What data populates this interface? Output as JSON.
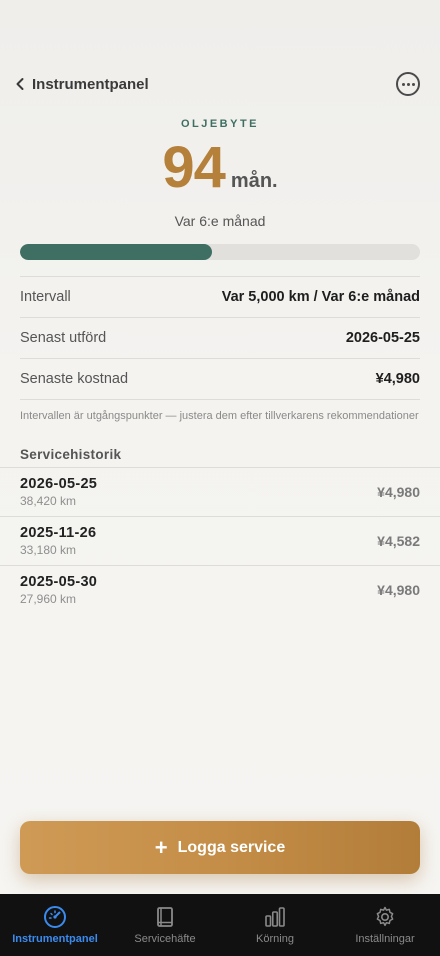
{
  "nav": {
    "back_label": "Instrumentpanel"
  },
  "hero": {
    "eyebrow": "OLJEBYTE",
    "value": "94",
    "unit": "mån.",
    "subtitle": "Var 6:e månad",
    "progress_fraction": 0.48
  },
  "details": [
    {
      "key": "Intervall",
      "value": "Var 5,000 km / Var 6:e månad"
    },
    {
      "key": "Senast utförd",
      "value": "2026-05-25"
    },
    {
      "key": "Senaste kostnad",
      "value": "¥4,980"
    }
  ],
  "hint": "Intervallen är utgångspunkter — justera dem efter tillverkarens rekommendationer",
  "history": {
    "title": "Servicehistorik",
    "entries": [
      {
        "date": "2026-05-25",
        "km": "38,420 km",
        "cost": "¥4,980"
      },
      {
        "date": "2025-11-26",
        "km": "33,180 km",
        "cost": "¥4,582"
      },
      {
        "date": "2025-05-30",
        "km": "27,960 km",
        "cost": "¥4,980"
      }
    ]
  },
  "cta": {
    "plus": "+",
    "label": "Logga service"
  },
  "tabs": [
    {
      "label": "Instrumentpanel",
      "icon": "gauge-icon",
      "active": true
    },
    {
      "label": "Servicehäfte",
      "icon": "book-icon",
      "active": false
    },
    {
      "label": "Körning",
      "icon": "bar-chart-icon",
      "active": false
    },
    {
      "label": "Inställningar",
      "icon": "gear-icon",
      "active": false
    }
  ],
  "colors": {
    "accent_green": "#3f6f63",
    "accent_gold": "#b5803a",
    "tab_active": "#3a8bf0"
  }
}
